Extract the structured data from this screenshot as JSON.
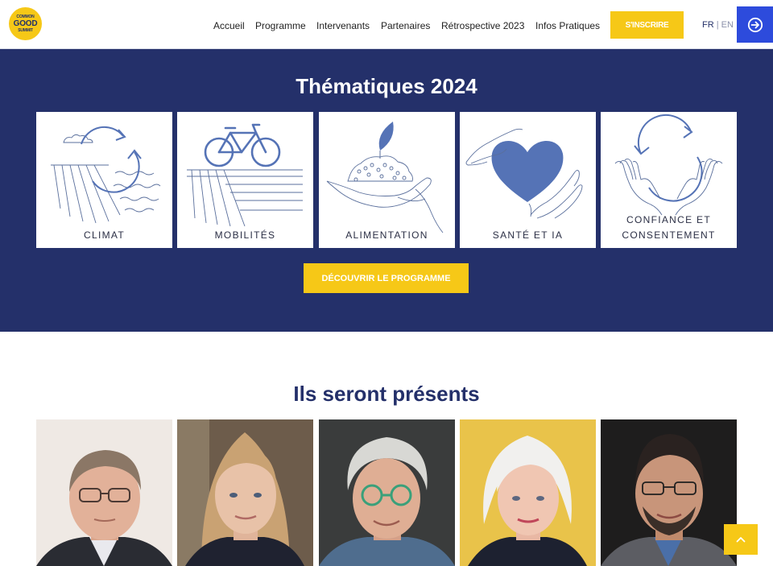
{
  "logo": {
    "line1": "COMMON",
    "line2": "GOOD",
    "line3": "SUMMIT"
  },
  "nav": [
    {
      "label": "Accueil"
    },
    {
      "label": "Programme"
    },
    {
      "label": "Intervenants"
    },
    {
      "label": "Partenaires"
    },
    {
      "label": "Rétrospective 2023"
    },
    {
      "label": "Infos Pratiques"
    }
  ],
  "header": {
    "signup_label": "S'INSCRIRE",
    "lang_fr": "FR",
    "lang_sep": "|",
    "lang_en": "EN",
    "login_icon": "login-arrow-icon"
  },
  "themes": {
    "title": "Thématiques 2024",
    "cards": [
      {
        "label": "CLIMAT",
        "icon": "climate-illustration"
      },
      {
        "label": "MOBILITÉS",
        "icon": "bicycle-illustration"
      },
      {
        "label": "ALIMENTATION",
        "icon": "food-illustration"
      },
      {
        "label": "SANTÉ ET IA",
        "icon": "heart-hands-illustration"
      },
      {
        "label_line1": "CONFIANCE ET",
        "label_line2": "CONSENTEMENT",
        "icon": "recycle-hands-illustration"
      }
    ],
    "cta_label": "DÉCOUVRIR LE PROGRAMME"
  },
  "speakers": {
    "title": "Ils seront présents",
    "photos": [
      {
        "name": "speaker-1",
        "bg": "#efe9e4"
      },
      {
        "name": "speaker-2",
        "bg": "#6d5c4b"
      },
      {
        "name": "speaker-3",
        "bg": "#3a3c3c"
      },
      {
        "name": "speaker-4",
        "bg": "#e9c34a"
      },
      {
        "name": "speaker-5",
        "bg": "#1e1d1d"
      }
    ]
  },
  "colors": {
    "navy": "#24306a",
    "yellow": "#f6c817",
    "blue": "#2d4bdc",
    "illustration": "#5573b6"
  }
}
